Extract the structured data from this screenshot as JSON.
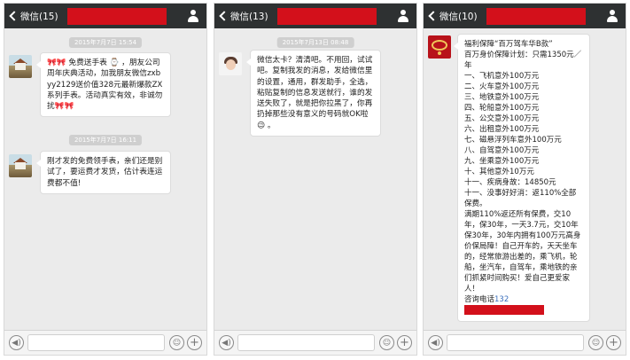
{
  "colors": {
    "topbar": "#2e3132",
    "chat_background": "#ebebeb",
    "redaction": "#d3101b",
    "link_blue": "#3a6fbd"
  },
  "icons": {
    "back": "chevron-left-icon",
    "contact": "person-icon",
    "voice": "voice-icon",
    "emoji": "emoji-icon",
    "more": "plus-icon"
  },
  "screens": [
    {
      "back_label": "微信(15)",
      "messages": [
        {
          "time": "2015年7月7日 15:54",
          "text": "🎀🎀 免费送手表 ⌚ ，朋友公司周年庆典活动，加我朋友微信zxbyy2129送价值328元最新爆款ZX系列手表。活动真实有效，非诚勿扰🎀🎀"
        },
        {
          "time": "2015年7月7日 16:11",
          "text": "刚才发的免费领手表，亲们还是别试了，要运费才发货，估计表连运费都不值!"
        }
      ]
    },
    {
      "back_label": "微信(13)",
      "messages": [
        {
          "time": "2015年7月13日 08:48",
          "text": "微信太卡？清清吧。不用回，试试吧。复制我发的消息，发给微信里的设置，通用，群发助手，全选，粘贴复制的信息发送就行，谁的发送失败了，就是把你拉黑了，你再扔掉那些没有意义的号码就OK啦 😉 。"
        }
      ]
    },
    {
      "back_label": "微信(10)",
      "messages": [
        {
          "text": "福利保障“百万驾车华B款”\n百万身价保障计划：只需1350元／年\n一、飞机意外100万元\n二、火车意外100万元\n三、地铁意外100万元\n四、轮船意外100万元\n五、公交意外100万元\n六、出租意外100万元\n七、磁悬浮列车意外100万元\n八、自驾意外100万元\n九、坐乘意外100万元\n十、其他意外10万元\n十一、疾病身故：14850元\n十一、没事好好消：返110%全部保费。\n满期110%返还所有保费，交10年，保30年，一天3.7元，交10年保30年，30年内拥有100万元高身价保局障！自己开车的，天天坐车的，经常旅游出差的，乘飞机，轮船，坐汽车，自驾车，乘地铁的亲们抓紧时间购买！爱自己更爱家人！",
          "contact_label": "咨询电话",
          "contact_number_prefix": "132"
        }
      ]
    }
  ]
}
